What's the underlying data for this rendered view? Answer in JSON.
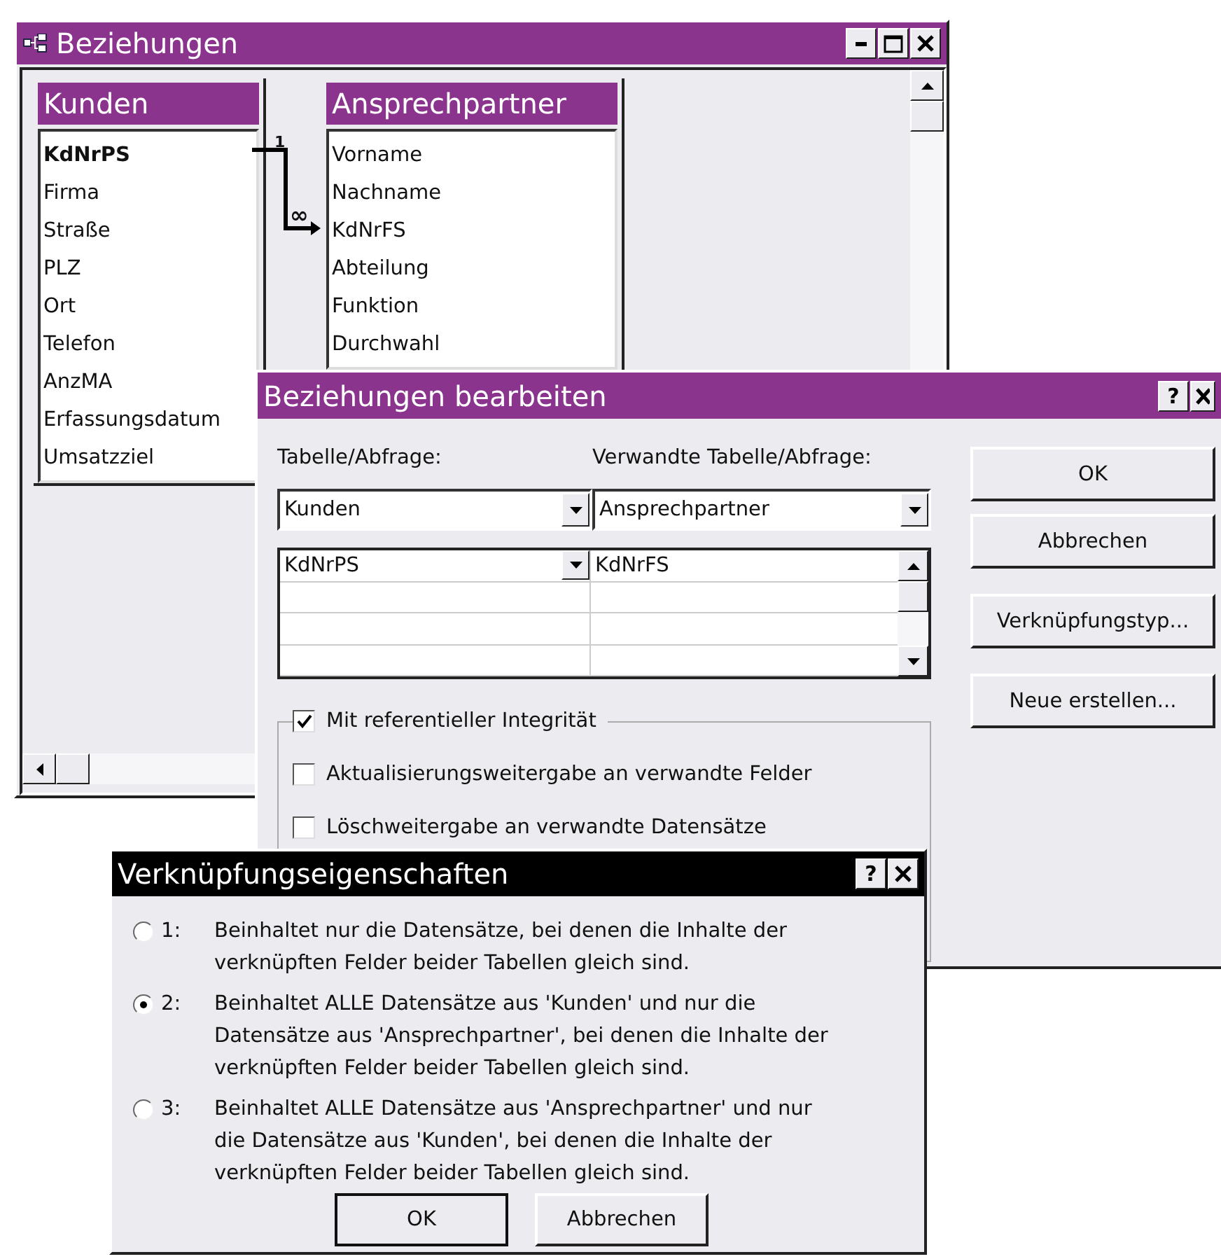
{
  "relationships_window": {
    "title": "Beziehungen",
    "tables": [
      {
        "title": "Kunden",
        "fields": [
          {
            "name": "KdNrPS",
            "key": true
          },
          {
            "name": "Firma",
            "key": false
          },
          {
            "name": "Straße",
            "key": false
          },
          {
            "name": "PLZ",
            "key": false
          },
          {
            "name": "Ort",
            "key": false
          },
          {
            "name": "Telefon",
            "key": false
          },
          {
            "name": "AnzMA",
            "key": false
          },
          {
            "name": "Erfassungsdatum",
            "key": false
          },
          {
            "name": "Umsatzziel",
            "key": false
          }
        ]
      },
      {
        "title": "Ansprechpartner",
        "fields": [
          {
            "name": "Vorname",
            "key": false
          },
          {
            "name": "Nachname",
            "key": false
          },
          {
            "name": "KdNrFS",
            "key": false
          },
          {
            "name": "Abteilung",
            "key": false
          },
          {
            "name": "Funktion",
            "key": false
          },
          {
            "name": "Durchwahl",
            "key": false
          }
        ]
      }
    ],
    "join": {
      "one_label": "1",
      "many_label": "∞"
    }
  },
  "edit_dialog": {
    "title": "Beziehungen bearbeiten",
    "help": "?",
    "table_label": "Tabelle/Abfrage:",
    "related_label": "Verwandte Tabelle/Abfrage:",
    "table_value": "Kunden",
    "related_value": "Ansprechpartner",
    "field_rows": [
      {
        "field": "KdNrPS",
        "related_field": "KdNrFS"
      }
    ],
    "options": [
      {
        "label": "Mit referentieller Integrität",
        "checked": true
      },
      {
        "label": "Aktualisierungsweitergabe an verwandte Felder",
        "checked": false
      },
      {
        "label": "Löschweitergabe an verwandte Datensätze",
        "checked": false
      }
    ],
    "buttons": [
      "OK",
      "Abbrechen",
      "Verknüpfungstyp...",
      "Neue erstellen..."
    ]
  },
  "join_dialog": {
    "title": "Verknüpfungseigenschaften",
    "help": "?",
    "options": [
      {
        "number": "1:",
        "lines": [
          "Beinhaltet nur die Datensätze, bei denen die Inhalte der",
          "verknüpften Felder beider Tabellen gleich sind."
        ],
        "selected": false
      },
      {
        "number": "2:",
        "lines": [
          "Beinhaltet ALLE Datensätze aus 'Kunden' und nur die",
          "Datensätze aus 'Ansprechpartner', bei denen die Inhalte der",
          "verknüpften Felder beider Tabellen gleich sind."
        ],
        "selected": true
      },
      {
        "number": "3:",
        "lines": [
          "Beinhaltet ALLE Datensätze aus 'Ansprechpartner' und nur",
          "die Datensätze aus 'Kunden', bei denen die Inhalte der",
          "verknüpften Felder beider Tabellen gleich sind."
        ],
        "selected": false
      }
    ],
    "buttons": [
      "OK",
      "Abbrechen"
    ]
  }
}
